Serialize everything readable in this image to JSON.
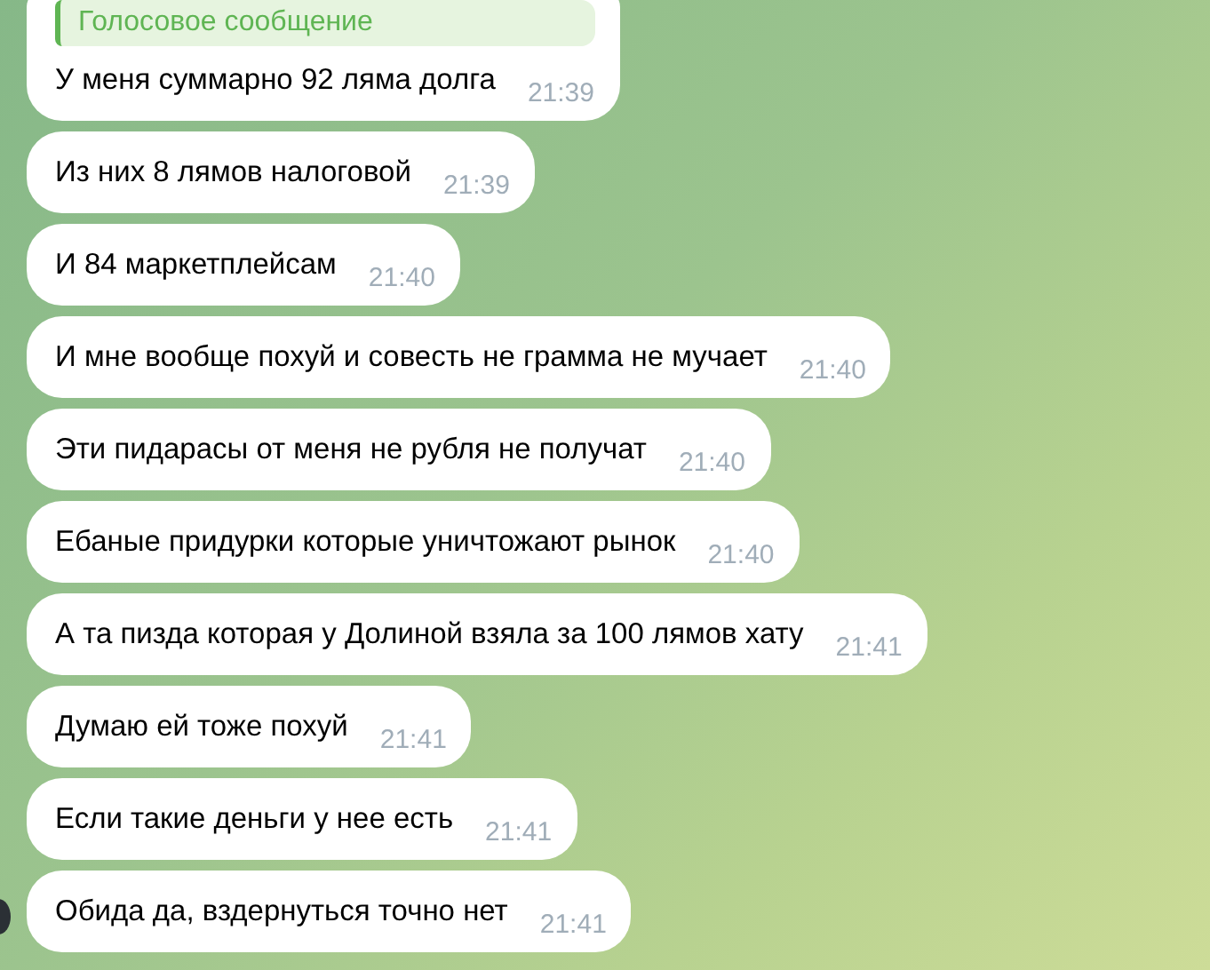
{
  "messages": [
    {
      "reply": {
        "text": "Голосовое сообщение"
      },
      "text": "У меня суммарно 92 ляма долга",
      "time": "21:39"
    },
    {
      "text": "Из них 8 лямов налоговой",
      "time": "21:39"
    },
    {
      "text": "И 84 маркетплейсам",
      "time": "21:40"
    },
    {
      "text": "И мне вообще похуй и совесть не грамма не мучает",
      "time": "21:40"
    },
    {
      "text": "Эти пидарасы от меня не рубля не получат",
      "time": "21:40"
    },
    {
      "text": "Ебаные придурки которые уничтожают рынок",
      "time": "21:40"
    },
    {
      "text": "А та пизда которая у Долиной взяла за 100 лямов хату",
      "time": "21:41"
    },
    {
      "text": "Думаю ей тоже похуй",
      "time": "21:41"
    },
    {
      "text": "Если такие деньги у нее есть",
      "time": "21:41"
    },
    {
      "text": "Обида да, вздернуться точно нет",
      "time": "21:41"
    }
  ]
}
